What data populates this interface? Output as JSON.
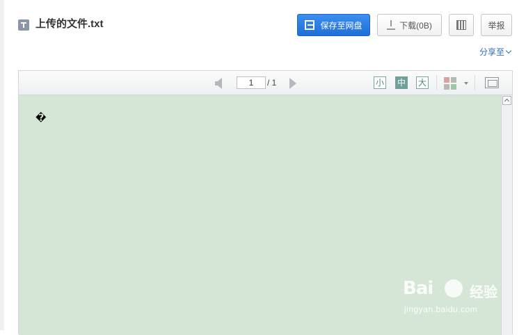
{
  "header": {
    "file_icon": "txt-file-icon",
    "title": "上传的文件.txt"
  },
  "actions": {
    "save_label": "保存至网盘",
    "download_label": "下载(0B)",
    "qr_icon": "qr-code-icon",
    "report_label": "举报",
    "share_label": "分享至"
  },
  "toolbar": {
    "current_page": "1",
    "total_pages": "/ 1",
    "font_small": "小",
    "font_medium": "中",
    "font_large": "大",
    "selected_font": "中"
  },
  "document": {
    "text": "�",
    "background_color": "#d5e6d7"
  },
  "watermark": {
    "brand": "Bai",
    "brand_zh": "经验",
    "url": "jingyan.baidu.com"
  },
  "colors": {
    "primary_button": "#1f6fd6",
    "link": "#2a6ebf"
  }
}
